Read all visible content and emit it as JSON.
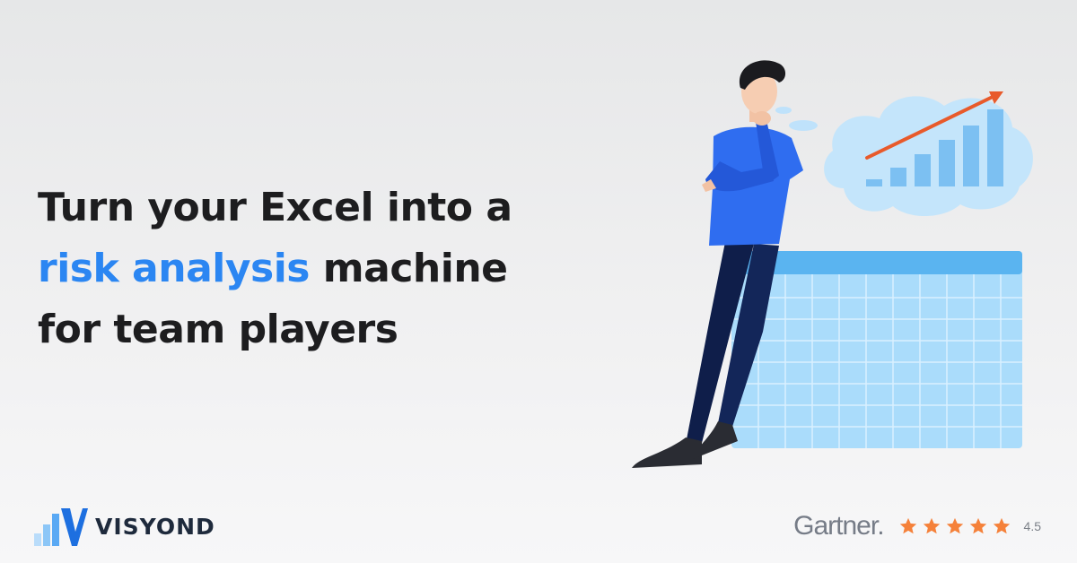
{
  "headline": {
    "line1": "Turn your Excel into a",
    "line2_accent": "risk analysis",
    "line2_rest": " machine",
    "line3": "for team players"
  },
  "brand": {
    "name": "VISYOND"
  },
  "rating": {
    "source": "Gartner.",
    "stars": 5,
    "score": "4.5"
  },
  "colors": {
    "accent": "#2b86f2",
    "text": "#1d1d1f",
    "star": "#f5813a",
    "shirt": "#2f6df0",
    "pants": "#0f1e4a",
    "chart_bars": "#7cc0f2",
    "trend_arrow": "#e85a2b",
    "table": "#aadcfb"
  },
  "icons": [
    "visyond-logo-icon",
    "star-icon",
    "thinking-person-illustration",
    "growth-chart-icon",
    "spreadsheet-table-icon"
  ]
}
